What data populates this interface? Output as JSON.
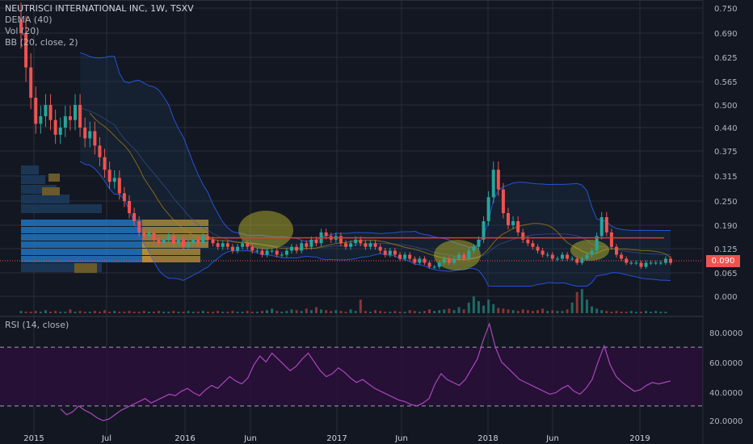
{
  "header": {
    "title": "NEUTRISCI INTERNATIONAL INC, 1W, TSXV",
    "indicators": [
      "DEMA (40)",
      "Vol (20)",
      "BB (20, close, 2)"
    ],
    "rsi_label": "RSI (14, close)"
  },
  "price_badge": "0.090",
  "colors": {
    "background": "#131722",
    "up": "#26a69a",
    "down": "#ef5350",
    "bb": "#2962ff",
    "dema": "#b8860b",
    "rsi": "#ab47bc",
    "rsi_band": "#2a0f3a",
    "resistance": "#e53935",
    "badge": "#ef5350",
    "vp_blue": "#1e6fb8",
    "vp_gold": "#c99a2e",
    "highlight": "#c6c42a"
  },
  "chart_data": [
    {
      "type": "candlestick",
      "title": "NEUTRISCI INTERNATIONAL INC, 1W, TSXV",
      "x_ticks": [
        "2015",
        "Jul",
        "2016",
        "Jun",
        "2017",
        "Jun",
        "2018",
        "Jun",
        "2019"
      ],
      "y_ticks": [
        "0.750",
        "0.690",
        "0.625",
        "0.565",
        "0.500",
        "0.440",
        "0.375",
        "0.315",
        "0.250",
        "0.190",
        "0.125",
        "0.065",
        "0.000"
      ],
      "ylim": [
        0.0,
        0.76
      ],
      "last_price": 0.09,
      "resistance_level": 0.155,
      "closes": [
        0.69,
        0.6,
        0.52,
        0.45,
        0.47,
        0.5,
        0.46,
        0.42,
        0.44,
        0.47,
        0.46,
        0.5,
        0.44,
        0.41,
        0.43,
        0.39,
        0.36,
        0.33,
        0.3,
        0.31,
        0.27,
        0.25,
        0.22,
        0.2,
        0.17,
        0.16,
        0.17,
        0.15,
        0.14,
        0.15,
        0.16,
        0.14,
        0.15,
        0.13,
        0.14,
        0.15,
        0.14,
        0.16,
        0.15,
        0.14,
        0.13,
        0.14,
        0.13,
        0.12,
        0.13,
        0.14,
        0.13,
        0.12,
        0.12,
        0.11,
        0.12,
        0.12,
        0.11,
        0.11,
        0.12,
        0.13,
        0.12,
        0.14,
        0.13,
        0.15,
        0.14,
        0.17,
        0.16,
        0.15,
        0.16,
        0.14,
        0.13,
        0.14,
        0.15,
        0.14,
        0.13,
        0.14,
        0.13,
        0.12,
        0.11,
        0.12,
        0.11,
        0.1,
        0.11,
        0.1,
        0.09,
        0.1,
        0.09,
        0.08,
        0.08,
        0.09,
        0.1,
        0.09,
        0.1,
        0.11,
        0.1,
        0.12,
        0.13,
        0.15,
        0.2,
        0.26,
        0.33,
        0.28,
        0.22,
        0.19,
        0.2,
        0.17,
        0.15,
        0.14,
        0.13,
        0.12,
        0.11,
        0.11,
        0.1,
        0.1,
        0.11,
        0.1,
        0.1,
        0.09,
        0.1,
        0.11,
        0.12,
        0.16,
        0.21,
        0.17,
        0.13,
        0.11,
        0.1,
        0.09,
        0.09,
        0.09,
        0.08,
        0.09,
        0.09,
        0.09,
        0.09,
        0.1,
        0.09
      ]
    },
    {
      "type": "bar",
      "title": "Vol (20)",
      "y_ticks": [
        "0.000"
      ],
      "values": [
        3,
        2,
        2,
        3,
        2,
        4,
        2,
        3,
        2,
        2,
        5,
        2,
        3,
        2,
        2,
        3,
        2,
        4,
        2,
        3,
        2,
        2,
        3,
        2,
        2,
        3,
        2,
        2,
        3,
        2,
        2,
        3,
        2,
        2,
        3,
        2,
        2,
        3,
        2,
        2,
        3,
        2,
        2,
        3,
        2,
        2,
        3,
        2,
        2,
        3,
        4,
        6,
        3,
        2,
        3,
        5,
        4,
        3,
        6,
        4,
        8,
        5,
        4,
        3,
        4,
        3,
        2,
        5,
        3,
        18,
        3,
        2,
        4,
        3,
        2,
        2,
        3,
        2,
        2,
        4,
        3,
        2,
        3,
        5,
        3,
        4,
        5,
        6,
        4,
        8,
        5,
        14,
        22,
        16,
        10,
        18,
        12,
        7,
        6,
        5,
        4,
        3,
        5,
        4,
        3,
        4,
        6,
        3,
        4,
        3,
        3,
        5,
        14,
        28,
        32,
        18,
        9,
        6,
        4,
        3,
        2,
        3,
        2,
        2,
        3,
        2,
        2,
        3,
        2,
        3,
        2,
        2
      ]
    },
    {
      "type": "line",
      "title": "RSI (14, close)",
      "y_ticks": [
        "80.0000",
        "60.0000",
        "40.0000",
        "20.0000"
      ],
      "ylim": [
        15,
        90
      ],
      "bands": [
        30,
        70
      ],
      "values": [
        28,
        24,
        26,
        30,
        27,
        25,
        22,
        20,
        21,
        24,
        27,
        29,
        31,
        33,
        35,
        32,
        34,
        36,
        38,
        37,
        40,
        42,
        39,
        37,
        41,
        44,
        42,
        46,
        50,
        47,
        45,
        49,
        58,
        64,
        60,
        66,
        62,
        58,
        54,
        57,
        62,
        66,
        60,
        54,
        50,
        52,
        56,
        53,
        49,
        46,
        48,
        45,
        42,
        40,
        38,
        36,
        34,
        33,
        31,
        30,
        32,
        35,
        45,
        52,
        48,
        46,
        44,
        48,
        55,
        62,
        75,
        86,
        70,
        60,
        56,
        52,
        48,
        46,
        44,
        42,
        40,
        38,
        39,
        42,
        44,
        40,
        38,
        42,
        48,
        60,
        71,
        58,
        50,
        46,
        43,
        40,
        41,
        44,
        46,
        45,
        46,
        47
      ]
    }
  ]
}
